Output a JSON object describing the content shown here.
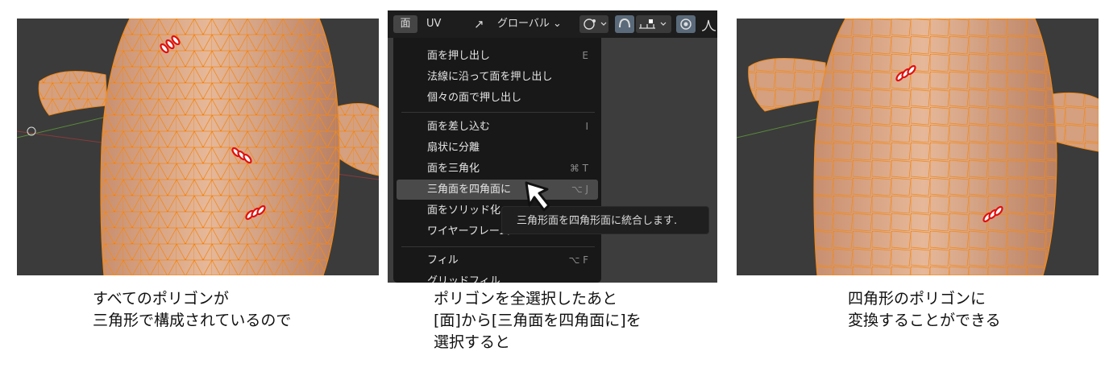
{
  "captions": {
    "left": "すべてのポリゴンが\n三角形で構成されているので",
    "middle": "ポリゴンを全選択したあと\n[面]から[三角面を四角面に]を\n選択すると",
    "right": "四角形のポリゴンに\n変換することができる"
  },
  "header": {
    "menu_face": "面",
    "menu_uv": "UV",
    "transform_orientation": "グローバル",
    "chevron": "⌄"
  },
  "face_menu": {
    "items": [
      {
        "label": "面を押し出し",
        "shortcut": "E"
      },
      {
        "label": "法線に沿って面を押し出し",
        "shortcut": ""
      },
      {
        "label": "個々の面で押し出し",
        "shortcut": ""
      },
      {
        "label": "面を差し込む",
        "shortcut": "I"
      },
      {
        "label": "扇状に分離",
        "shortcut": ""
      },
      {
        "label": "面を三角化",
        "shortcut": "⌘ T"
      },
      {
        "label": "三角面を四角面に",
        "shortcut": "⌥ J"
      },
      {
        "label": "面をソリッド化",
        "shortcut": ""
      },
      {
        "label": "ワイヤーフレーム",
        "shortcut": ""
      },
      {
        "label": "フィル",
        "shortcut": "⌥ F"
      },
      {
        "label": "グリッドフィル",
        "shortcut": ""
      }
    ]
  },
  "tooltip": "三角形面を四角形面に統合します.",
  "colors": {
    "mesh_fill": "#d7a585",
    "wire": "#ff8c1a",
    "viewport_bg": "#3b3b3b",
    "menu_bg": "#181818",
    "highlight": "#4a4a4a"
  }
}
